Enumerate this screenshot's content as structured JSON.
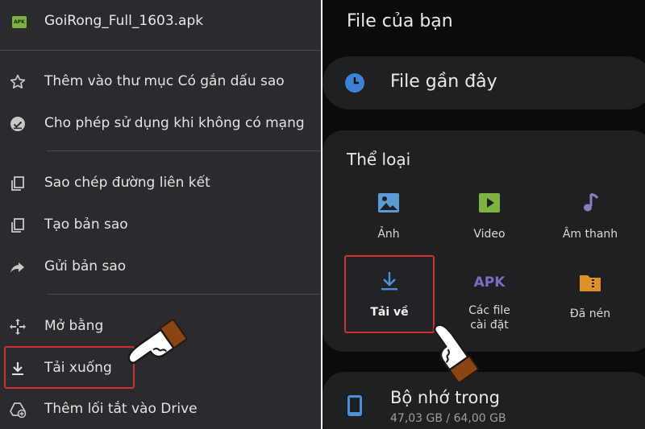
{
  "left_panel": {
    "file_badge": "APK",
    "file_name": "GoiRong_Full_1603.apk",
    "menu": [
      {
        "label": "Thêm vào thư mục Có gắn dấu sao",
        "icon": "star-icon"
      },
      {
        "label": "Cho phép sử dụng khi không có mạng",
        "icon": "offline-icon"
      },
      {
        "label": "Sao chép đường liên kết",
        "icon": "copy-icon"
      },
      {
        "label": "Tạo bản sao",
        "icon": "duplicate-icon"
      },
      {
        "label": "Gửi bản sao",
        "icon": "share-arrow-icon"
      },
      {
        "label": "Mở bằng",
        "icon": "open-with-icon"
      },
      {
        "label": "Tải xuống",
        "icon": "download-icon"
      },
      {
        "label": "Thêm lối tắt vào Drive",
        "icon": "add-shortcut-icon"
      }
    ]
  },
  "right_panel": {
    "title": "File của bạn",
    "recent_label": "File gần đây",
    "categories_title": "Thể loại",
    "categories": [
      {
        "label": "Ảnh",
        "icon": "image-icon",
        "color": "#5b9bd5"
      },
      {
        "label": "Video",
        "icon": "video-icon",
        "color": "#7cb342"
      },
      {
        "label": "Âm thanh",
        "icon": "music-icon",
        "color": "#8e7cc3"
      },
      {
        "label": "Tải về",
        "icon": "download-icon",
        "color": "#4a90d9"
      },
      {
        "label": "Các file cài đặt",
        "line1": "Các file",
        "line2": "cài đặt",
        "icon": "apk-icon",
        "icon_text": "APK",
        "color": "#7e6bc4"
      },
      {
        "label": "Đã nén",
        "icon": "folder-zip-icon",
        "color": "#e0902a"
      }
    ],
    "storage": {
      "name": "Bộ nhớ trong",
      "size": "47,03 GB / 64,00 GB"
    }
  },
  "colors": {
    "highlight": "#d32f2f",
    "left_bg": "#2a2b2e",
    "right_bg": "#0b0b0b",
    "card_bg": "#1f2022"
  }
}
